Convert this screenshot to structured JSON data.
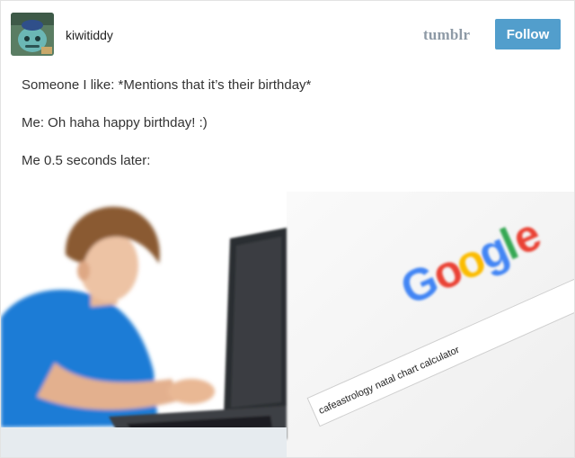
{
  "post": {
    "username": "kiwitiddy",
    "brand": "tumblr",
    "follow_label": "Follow",
    "lines": [
      "Someone I like: *Mentions that it’s their birthday*",
      "Me: Oh haha happy birthday! :)",
      "Me 0.5 seconds later:"
    ]
  },
  "meme": {
    "logo_letters": [
      "G",
      "o",
      "o",
      "g",
      "l",
      "e"
    ],
    "search_query": "cafeastrology natal chart calculator"
  },
  "colors": {
    "follow_button": "#529ecc",
    "brand_text": "#8e9aa6",
    "google_blue": "#4285f4",
    "google_red": "#ea4335",
    "google_yellow": "#fbbc05",
    "google_green": "#34a853"
  }
}
